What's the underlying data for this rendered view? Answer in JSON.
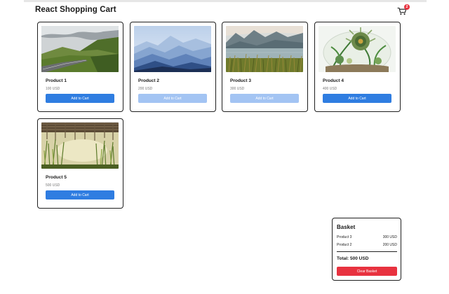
{
  "app": {
    "title": "React Shopping Cart"
  },
  "header": {
    "cart_icon": "cart-icon",
    "cart_count": "2"
  },
  "products": [
    {
      "name": "Product 1",
      "price": "100 USD",
      "button": "Add to Cart",
      "in_basket": false,
      "image": "mountain road valley"
    },
    {
      "name": "Product 2",
      "price": "200 USD",
      "button": "Add to Cart",
      "in_basket": true,
      "image": "misty blue mountains"
    },
    {
      "name": "Product 3",
      "price": "300 USD",
      "button": "Add to Cart",
      "in_basket": true,
      "image": "lake with mountains and reeds"
    },
    {
      "name": "Product 4",
      "price": "400 USD",
      "button": "Add to Cart",
      "in_basket": false,
      "image": "succulent terrarium"
    },
    {
      "name": "Product 5",
      "price": "500 USD",
      "button": "Add to Cart",
      "in_basket": false,
      "image": "wooden bridge with reeds"
    }
  ],
  "basket": {
    "title": "Basket",
    "items": [
      {
        "name": "Product 3",
        "price": "300 USD"
      },
      {
        "name": "Product 2",
        "price": "200 USD"
      }
    ],
    "total": "Total: 500 USD",
    "clear_label": "Clear Basket"
  },
  "colors": {
    "primary": "#2f7de1",
    "primary_disabled": "#a3c4f3",
    "danger": "#e8323f",
    "border": "#1f1f1f"
  }
}
